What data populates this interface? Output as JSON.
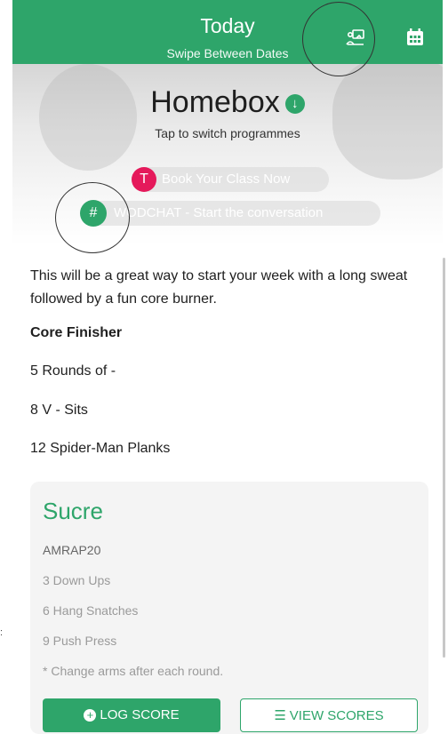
{
  "header": {
    "title": "Today",
    "subtitle": "Swipe Between Dates",
    "icons": [
      "switch-programme-icon",
      "calendar-icon"
    ],
    "color": "#2ea56a"
  },
  "programme": {
    "name": "Homebox",
    "hint": "Tap to switch programmes",
    "arrow_glyph": "↓"
  },
  "pills": {
    "book_badge": "T",
    "book_label": "Book Your Class Now",
    "chat_badge": "#",
    "chat_label": "WODCHAT - Start the conversation"
  },
  "workout": {
    "intro": "This will be a great way to start your week with a long sweat followed by a fun core burner.",
    "heading": "Core Finisher",
    "lines": [
      "5 Rounds of -",
      "8 V - Sits",
      "12 Spider-Man Planks"
    ]
  },
  "card": {
    "title": "Sucre",
    "lines": [
      "AMRAP20",
      "3 Down Ups",
      "6 Hang Snatches",
      "9 Push Press",
      "* Change arms after each round."
    ],
    "log_label": "LOG SCORE",
    "view_label": "VIEW SCORES"
  },
  "colors": {
    "accent": "#2ea56a",
    "badge_pink": "#e5195b",
    "card_bg": "#f4f4f4"
  }
}
